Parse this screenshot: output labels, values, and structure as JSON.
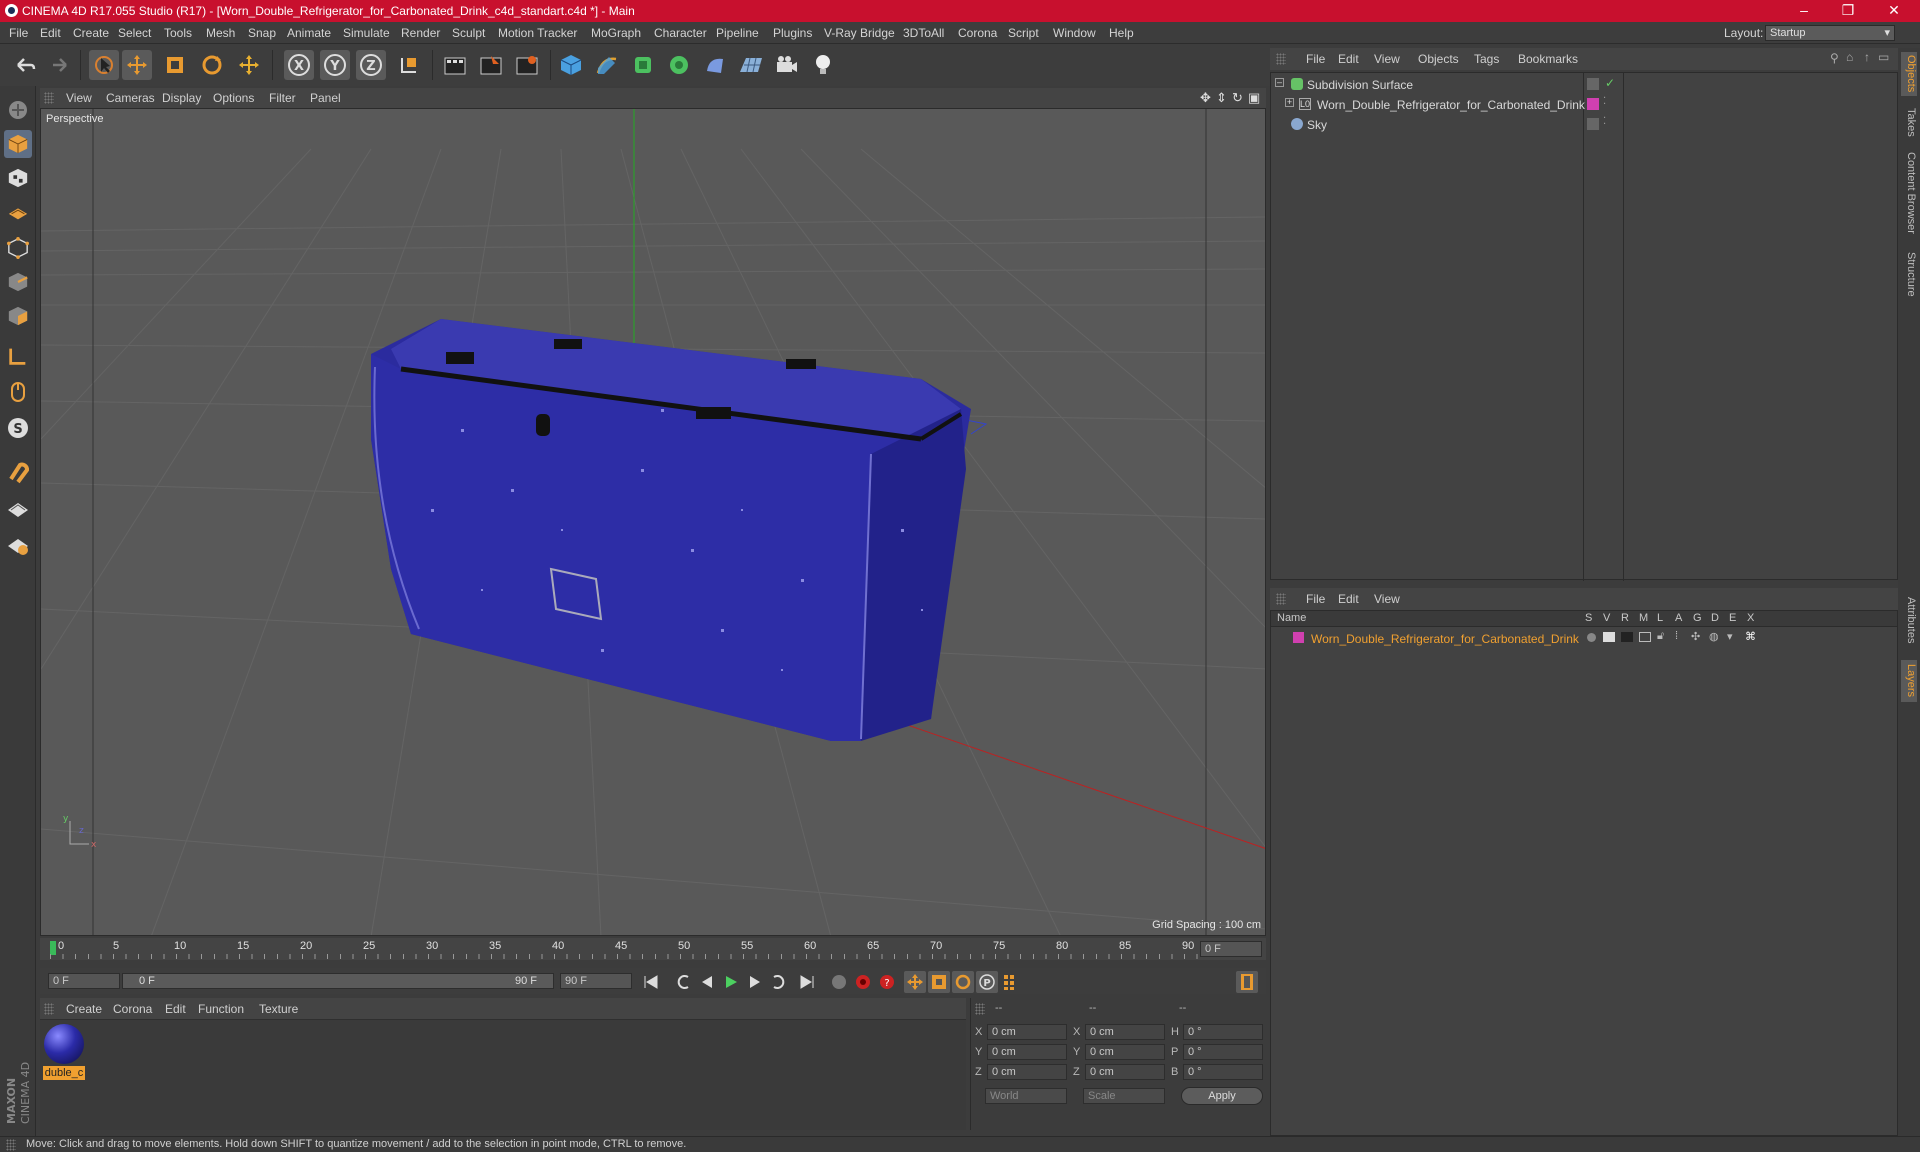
{
  "window": {
    "title": "CINEMA 4D R17.055 Studio (R17) - [Worn_Double_Refrigerator_for_Carbonated_Drink_c4d_standart.c4d *] - Main"
  },
  "menubar": {
    "items": [
      "File",
      "Edit",
      "Create",
      "Select",
      "Tools",
      "Mesh",
      "Snap",
      "Animate",
      "Simulate",
      "Render",
      "Sculpt",
      "Motion Tracker",
      "MoGraph",
      "Character",
      "Pipeline",
      "Plugins",
      "V-Ray Bridge",
      "3DToAll",
      "Corona",
      "Script",
      "Window",
      "Help"
    ],
    "layout_label": "Layout:",
    "layout_value": "Startup"
  },
  "viewport": {
    "menu": [
      "View",
      "Cameras",
      "Display",
      "Options",
      "Filter",
      "Panel"
    ],
    "label": "Perspective",
    "grid_spacing": "Grid Spacing : 100 cm"
  },
  "timeline": {
    "ticks": [
      "0",
      "5",
      "10",
      "15",
      "20",
      "25",
      "30",
      "35",
      "40",
      "45",
      "50",
      "55",
      "60",
      "65",
      "70",
      "75",
      "80",
      "85",
      "90"
    ],
    "current_frame": "0 F",
    "start_field": "0 F",
    "range_start": "0 F",
    "range_end": "90 F",
    "end_field": "90 F"
  },
  "material_manager": {
    "menu": [
      "Create",
      "Corona",
      "Edit",
      "Function",
      "Texture"
    ],
    "materials": [
      {
        "name": "duble_c"
      }
    ]
  },
  "coordinates": {
    "header": [
      "--",
      "--",
      "--"
    ],
    "rows": [
      {
        "a": "X",
        "v1": "0 cm",
        "b": "X",
        "v2": "0 cm",
        "c": "H",
        "v3": "0 °"
      },
      {
        "a": "Y",
        "v1": "0 cm",
        "b": "Y",
        "v2": "0 cm",
        "c": "P",
        "v3": "0 °"
      },
      {
        "a": "Z",
        "v1": "0 cm",
        "b": "Z",
        "v2": "0 cm",
        "c": "B",
        "v3": "0 °"
      }
    ],
    "mode1": "World",
    "mode2": "Scale",
    "apply": "Apply"
  },
  "object_manager": {
    "menu": [
      "File",
      "Edit",
      "View",
      "Objects",
      "Tags",
      "Bookmarks"
    ],
    "objects": [
      {
        "name": "Subdivision Surface",
        "color": "#66c266"
      },
      {
        "name": "Worn_Double_Refrigerator_for_Carbonated_Drink",
        "color": "#d040b0"
      },
      {
        "name": "Sky",
        "color": "#8aa8d0"
      }
    ]
  },
  "layer_manager": {
    "menu": [
      "File",
      "Edit",
      "View"
    ],
    "columns": [
      "Name",
      "S",
      "V",
      "R",
      "M",
      "L",
      "A",
      "G",
      "D",
      "E",
      "X"
    ],
    "layers": [
      {
        "name": "Worn_Double_Refrigerator_for_Carbonated_Drink",
        "color": "#d040b0"
      }
    ]
  },
  "right_tabs": [
    "Objects",
    "Takes",
    "Content Browser",
    "Structure",
    "Attributes",
    "Layers"
  ],
  "branding": "MAXON CINEMA 4D",
  "status": "Move: Click and drag to move elements. Hold down SHIFT to quantize movement / add to the selection in point mode, CTRL to remove.",
  "colors": {
    "title_bar": "#c8102e",
    "fridge": "#2a2a9a",
    "accent_orange": "#f0a030"
  }
}
